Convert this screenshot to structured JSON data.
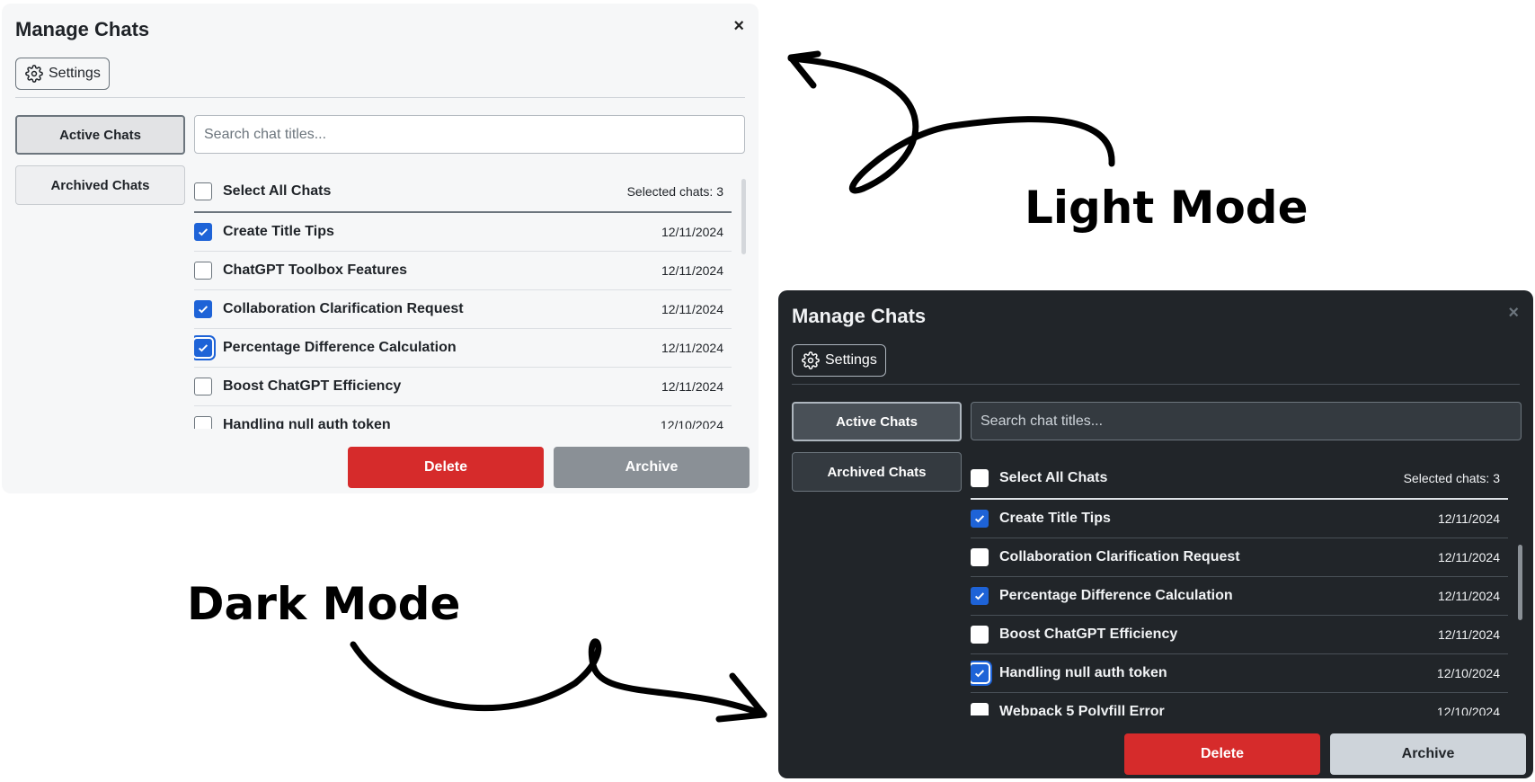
{
  "annotations": {
    "light_label": "Light Mode",
    "dark_label": "Dark Mode"
  },
  "light": {
    "title": "Manage Chats",
    "close_glyph": "×",
    "settings_label": "Settings",
    "tabs": {
      "active": "Active Chats",
      "archived": "Archived Chats"
    },
    "search_placeholder": "Search chat titles...",
    "select_all_label": "Select All Chats",
    "selected_count": "Selected chats: 3",
    "chats": [
      {
        "title": "Create Title Tips",
        "date": "12/11/2024",
        "checked": true
      },
      {
        "title": "ChatGPT Toolbox Features",
        "date": "12/11/2024",
        "checked": false
      },
      {
        "title": "Collaboration Clarification Request",
        "date": "12/11/2024",
        "checked": true
      },
      {
        "title": "Percentage Difference Calculation",
        "date": "12/11/2024",
        "checked": true
      },
      {
        "title": "Boost ChatGPT Efficiency",
        "date": "12/11/2024",
        "checked": false
      },
      {
        "title": "Handling null auth token",
        "date": "12/10/2024",
        "checked": false
      }
    ],
    "delete_label": "Delete",
    "archive_label": "Archive"
  },
  "dark": {
    "title": "Manage Chats",
    "close_glyph": "×",
    "settings_label": "Settings",
    "tabs": {
      "active": "Active Chats",
      "archived": "Archived Chats"
    },
    "search_placeholder": "Search chat titles...",
    "select_all_label": "Select All Chats",
    "selected_count": "Selected chats: 3",
    "chats": [
      {
        "title": "Create Title Tips",
        "date": "12/11/2024",
        "checked": true
      },
      {
        "title": "Collaboration Clarification Request",
        "date": "12/11/2024",
        "checked": false
      },
      {
        "title": "Percentage Difference Calculation",
        "date": "12/11/2024",
        "checked": true
      },
      {
        "title": "Boost ChatGPT Efficiency",
        "date": "12/11/2024",
        "checked": false
      },
      {
        "title": "Handling null auth token",
        "date": "12/10/2024",
        "checked": true
      },
      {
        "title": "Webpack 5 Polyfill Error",
        "date": "12/10/2024",
        "checked": false
      }
    ],
    "delete_label": "Delete",
    "archive_label": "Archive"
  },
  "colors": {
    "accent_blue": "#1e63d7",
    "delete_red": "#d62b2b",
    "light_bg": "#f6f7f8",
    "dark_bg": "#212529"
  },
  "icons": {
    "settings": "gear-icon",
    "close": "close-icon",
    "check": "check-icon"
  }
}
